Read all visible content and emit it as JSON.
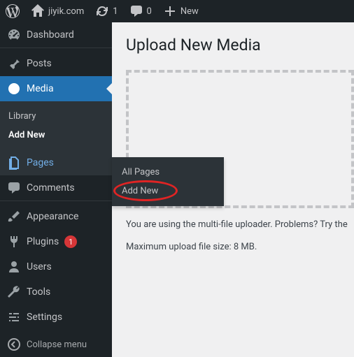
{
  "toolbar": {
    "site_name": "jiyik.com",
    "updates_count": "1",
    "comments_count": "0",
    "new_label": "New"
  },
  "sidebar": {
    "dashboard": "Dashboard",
    "posts": "Posts",
    "media": "Media",
    "media_sub": {
      "library": "Library",
      "add_new": "Add New"
    },
    "pages": "Pages",
    "comments": "Comments",
    "appearance": "Appearance",
    "plugins": "Plugins",
    "plugins_badge": "1",
    "users": "Users",
    "tools": "Tools",
    "settings": "Settings",
    "collapse": "Collapse menu"
  },
  "flyout": {
    "all_pages": "All Pages",
    "add_new": "Add New"
  },
  "main": {
    "title": "Upload New Media",
    "notice_line1": "You are using the multi-file uploader. Problems? Try the",
    "notice_line2": "Maximum upload file size: 8 MB."
  }
}
